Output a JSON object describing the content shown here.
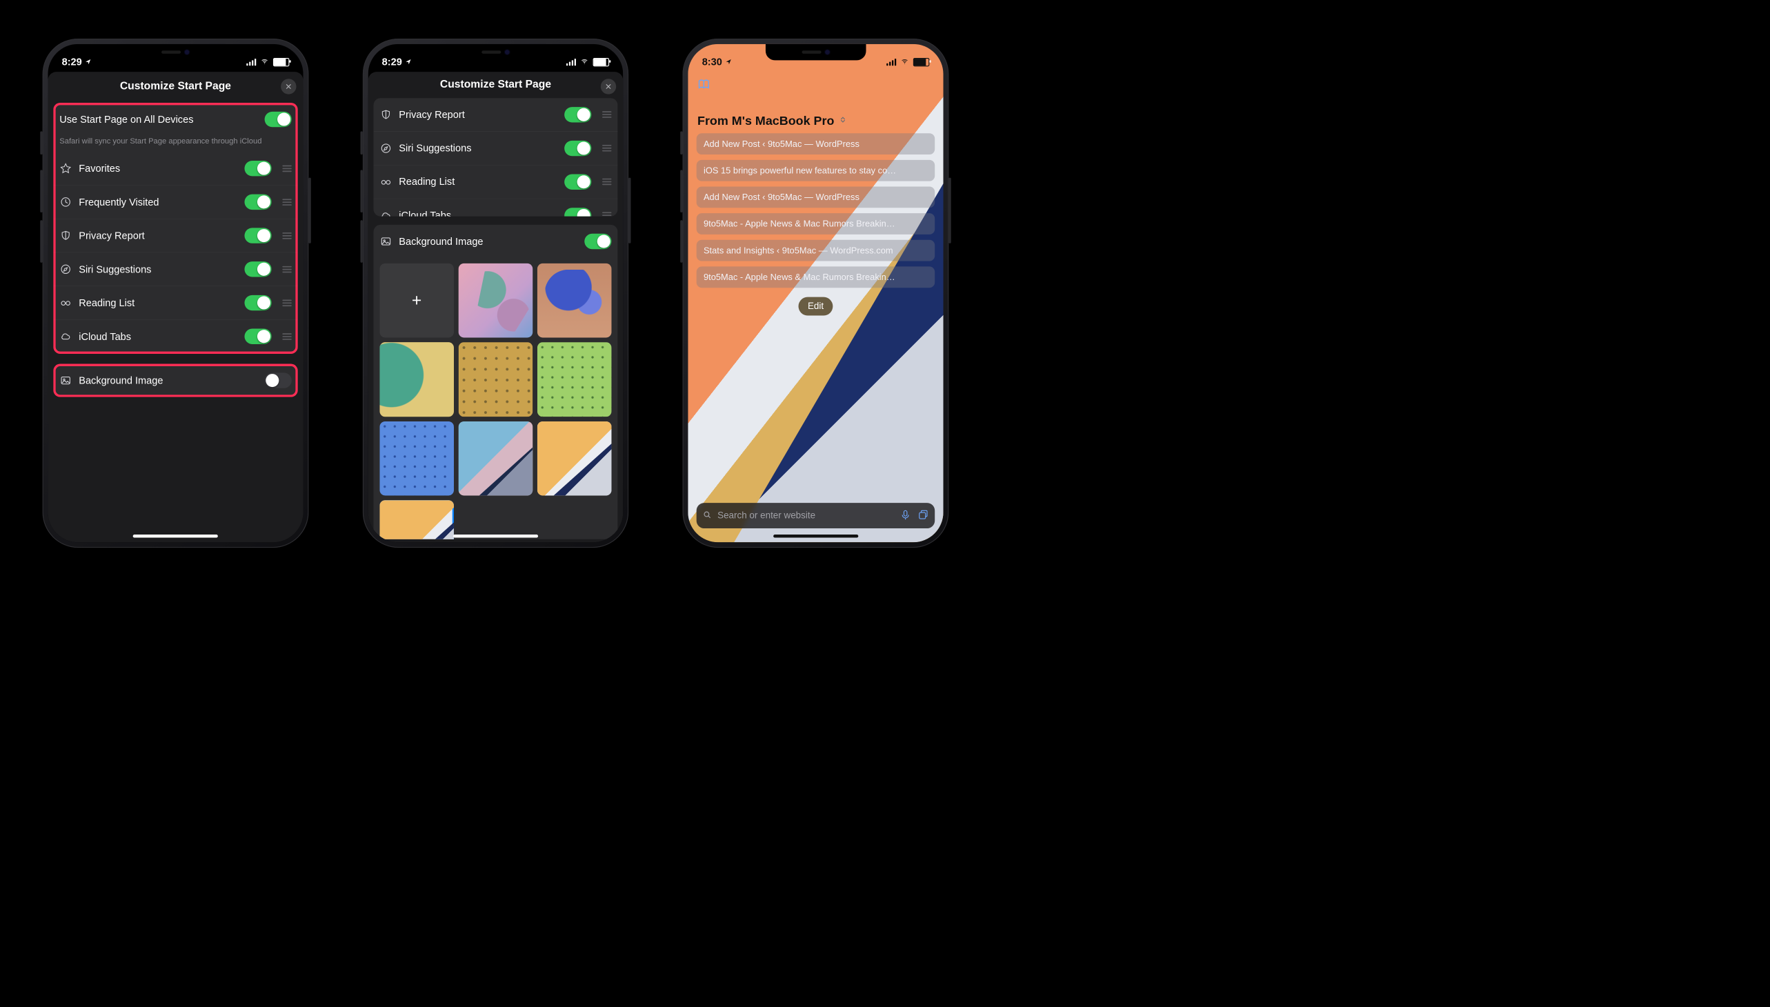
{
  "statusbar": {
    "time_a": "8:29",
    "time_b": "8:29",
    "time_c": "8:30"
  },
  "sheet_title": "Customize Start Page",
  "sync_row": {
    "label": "Use Start Page on All Devices",
    "help": "Safari will sync your Start Page appearance through iCloud",
    "on": true
  },
  "options": [
    {
      "icon": "star",
      "label": "Favorites",
      "on": true
    },
    {
      "icon": "clock",
      "label": "Frequently Visited",
      "on": true
    },
    {
      "icon": "shield",
      "label": "Privacy Report",
      "on": true
    },
    {
      "icon": "compass",
      "label": "Siri Suggestions",
      "on": true
    },
    {
      "icon": "glasses",
      "label": "Reading List",
      "on": true
    },
    {
      "icon": "cloud",
      "label": "iCloud Tabs",
      "on": true
    }
  ],
  "bg_section": {
    "label": "Background Image",
    "on_phone1": false,
    "on_phone2": true
  },
  "thumbs": [
    {
      "kind": "add"
    },
    {
      "kind": "butterfly"
    },
    {
      "kind": "crab"
    },
    {
      "kind": "chameleon"
    },
    {
      "kind": "dotted-y"
    },
    {
      "kind": "dotted-g"
    },
    {
      "kind": "dotted-b"
    },
    {
      "kind": "fold-1"
    },
    {
      "kind": "fold-2"
    },
    {
      "kind": "fold-2",
      "selected": true
    }
  ],
  "start_page": {
    "section_title": "From M's MacBook Pro",
    "links": [
      "Add New Post ‹ 9to5Mac — WordPress",
      "iOS 15 brings powerful new features to stay co…",
      "Add New Post ‹ 9to5Mac — WordPress",
      "9to5Mac - Apple News & Mac Rumors Breakin…",
      "Stats and Insights ‹ 9to5Mac — WordPress.com",
      "9to5Mac - Apple News & Mac Rumors Breakin…"
    ],
    "edit_label": "Edit",
    "search_placeholder": "Search or enter website"
  }
}
